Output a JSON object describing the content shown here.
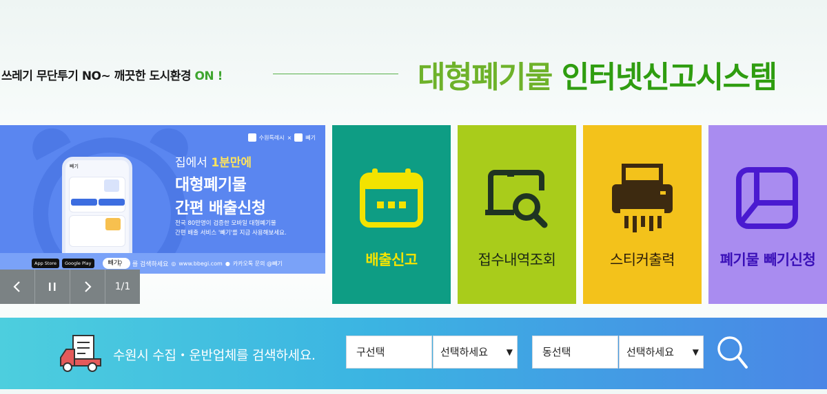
{
  "header": {
    "slogan_main": "쓰레기 무단투기 NO~ 깨끗한 도시환경",
    "slogan_on": "ON !",
    "title_part1": "대형폐기물",
    "title_part2": "인터넷신고시스템"
  },
  "banner": {
    "brand_left": "수원특례시",
    "brand_x": "×",
    "brand_right": "빼기",
    "phone_title": "빼기",
    "sub_prefix": "집에서",
    "sub_highlight": "1분만에",
    "title_line1": "대형폐기물",
    "title_line2": "간편 배출신청",
    "desc_line1": "전국 80만명이 검증한 모바일 대형폐기물",
    "desc_line2": "간편 배출 서비스 '빼기'를 지금 사용해보세요.",
    "app_store": "App Store",
    "google_play": "Google Play",
    "search_word": "빼기",
    "search_suffix": "를 검색하세요",
    "website": "www.bbegi.com",
    "kakao": "카카오톡 문의 @빼기"
  },
  "slider_controls": {
    "prev_icon": "chevron-left-icon",
    "pause_icon": "pause-icon",
    "next_icon": "chevron-right-icon",
    "counter": "1/1"
  },
  "menu": [
    {
      "label": "배출신고",
      "icon": "calendar-icon",
      "bg": "#0e9d84"
    },
    {
      "label": "접수내역조회",
      "icon": "monitor-search-icon",
      "bg": "#a9cc1b"
    },
    {
      "label": "스티커출력",
      "icon": "printer-icon",
      "bg": "#f3c21b"
    },
    {
      "label": "폐기물 빼기신청",
      "icon": "layout-icon",
      "bg": "#a98cf0"
    }
  ],
  "search": {
    "prompt": "수원시 수집・운반업체를 검색하세요.",
    "gu_label": "구선택",
    "gu_select": "선택하세요",
    "dong_label": "동선택",
    "dong_select": "선택하세요",
    "button_icon": "search-icon"
  }
}
